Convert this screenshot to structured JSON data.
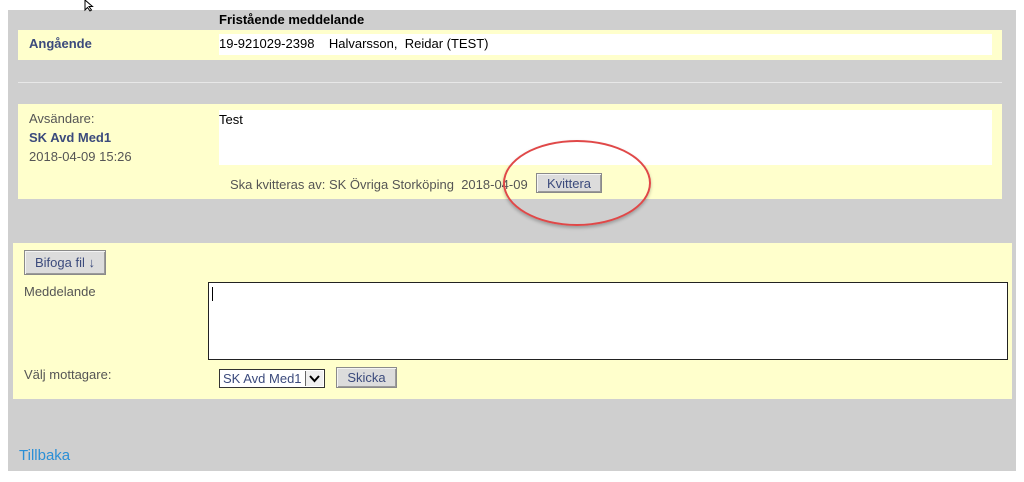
{
  "header": {
    "title": "Fristående meddelande"
  },
  "regarding": {
    "label": "Angående",
    "value": "19-921029-2398    Halvarsson,  Reidar (TEST)"
  },
  "message": {
    "sender_label": "Avsändare:",
    "sender_name": "SK Avd Med1",
    "sender_date": "2018-04-09 15:26",
    "body": "Test",
    "ack_text": "Ska kvitteras av: SK Övriga Storköping  2018-04-09",
    "ack_button": "Kvittera"
  },
  "compose": {
    "attach_button": "Bifoga fil ↓",
    "message_label": "Meddelande",
    "message_value": "",
    "recipient_label": "Välj mottagare:",
    "recipient_selected": "SK Avd Med1",
    "send_button": "Skicka"
  },
  "footer": {
    "back_link": "Tillbaka"
  },
  "colors": {
    "frame": "#cfcfcf",
    "panel": "#ffffcc",
    "accent": "#3b4a7c",
    "link": "#2b8fd6",
    "highlight": "#e04848"
  }
}
